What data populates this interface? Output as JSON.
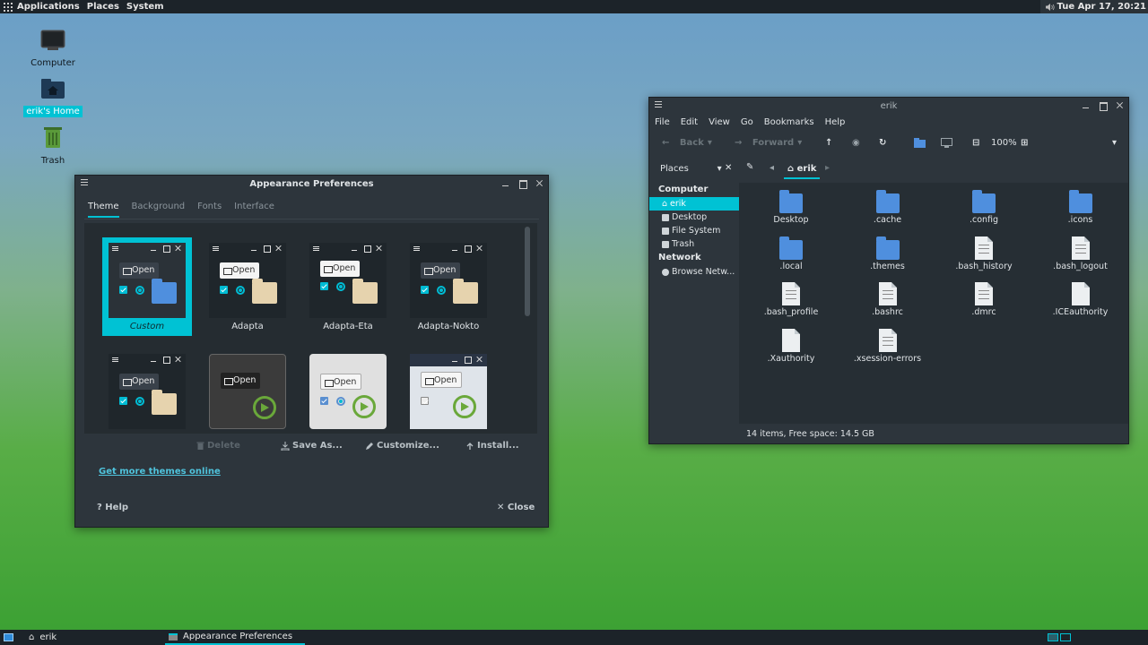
{
  "top_panel": {
    "menus": [
      "Applications",
      "Places",
      "System"
    ],
    "clock": "Tue Apr 17, 20:21"
  },
  "desktop": {
    "icons": [
      {
        "label": "Computer"
      },
      {
        "label": "erik's Home"
      },
      {
        "label": "Trash"
      }
    ]
  },
  "appearance": {
    "title": "Appearance Preferences",
    "tabs": [
      "Theme",
      "Background",
      "Fonts",
      "Interface"
    ],
    "open_label": "Open",
    "themes": [
      {
        "name": "Custom"
      },
      {
        "name": "Adapta"
      },
      {
        "name": "Adapta-Eta"
      },
      {
        "name": "Adapta-Nokto"
      }
    ],
    "actions": {
      "delete": "Delete",
      "save_as": "Save As...",
      "customize": "Customize...",
      "install": "Install..."
    },
    "get_more": "Get more themes online",
    "help": "Help",
    "close": "Close"
  },
  "file_manager": {
    "title": "erik",
    "menus": [
      "File",
      "Edit",
      "View",
      "Go",
      "Bookmarks",
      "Help"
    ],
    "toolbar": {
      "back": "Back",
      "forward": "Forward",
      "zoom": "100%"
    },
    "places_label": "Places",
    "breadcrumb": "erik",
    "sidebar": {
      "computer_header": "Computer",
      "computer_items": [
        "erik",
        "Desktop",
        "File System",
        "Trash"
      ],
      "network_header": "Network",
      "network_items": [
        "Browse Netw..."
      ]
    },
    "files": [
      {
        "name": "Desktop",
        "type": "folder"
      },
      {
        "name": ".cache",
        "type": "folder"
      },
      {
        "name": ".config",
        "type": "folder"
      },
      {
        "name": ".icons",
        "type": "folder"
      },
      {
        "name": ".local",
        "type": "folder"
      },
      {
        "name": ".themes",
        "type": "folder"
      },
      {
        "name": ".bash_history",
        "type": "doc"
      },
      {
        "name": ".bash_logout",
        "type": "doc"
      },
      {
        "name": ".bash_profile",
        "type": "doc"
      },
      {
        "name": ".bashrc",
        "type": "doc"
      },
      {
        "name": ".dmrc",
        "type": "doc"
      },
      {
        "name": ".ICEauthority",
        "type": "blank"
      },
      {
        "name": ".Xauthority",
        "type": "blank"
      },
      {
        "name": ".xsession-errors",
        "type": "doc"
      }
    ],
    "status": "14 items, Free space: 14.5 GB"
  },
  "taskbar": {
    "tasks": [
      "erik",
      "Appearance Preferences"
    ]
  },
  "colors": {
    "accent": "#00c2d4",
    "panel": "#1c2329",
    "window": "#2d353c"
  }
}
